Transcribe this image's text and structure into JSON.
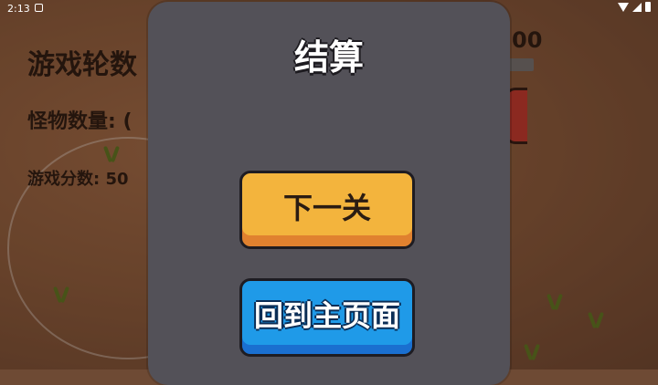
{
  "status_bar": {
    "time": "2:13"
  },
  "hud": {
    "round_label": "游戏轮数",
    "monster_label": "怪物数量: (",
    "score_label": "游戏分数: 50",
    "right_number": "00"
  },
  "dialog": {
    "title": "结算",
    "next_button": "下一关",
    "home_button": "回到主页面"
  },
  "colors": {
    "dialog_bg": "#535158",
    "next_button": "#f3b43d",
    "home_button": "#1f9ae8",
    "ground": "#8a5a3c"
  }
}
